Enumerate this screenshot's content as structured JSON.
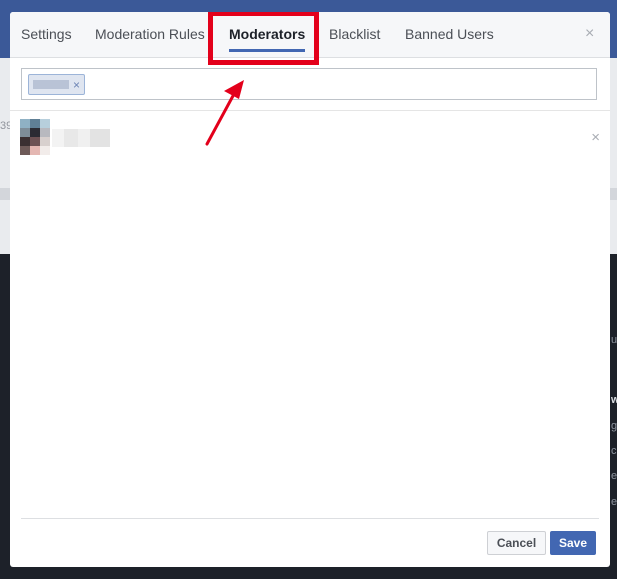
{
  "background": {
    "fragments": [
      "39",
      "u",
      "ws",
      "g",
      "co",
      "ec",
      "ed"
    ]
  },
  "dialog": {
    "tabs": [
      {
        "label": "Settings"
      },
      {
        "label": "Moderation Rules"
      },
      {
        "label": "Moderators"
      },
      {
        "label": "Blacklist"
      },
      {
        "label": "Banned Users"
      }
    ],
    "active_tab": "Moderators",
    "close_glyph": "×",
    "token_input": {
      "token_remove_glyph": "×"
    },
    "moderator_row": {
      "remove_glyph": "×"
    },
    "buttons": {
      "cancel_label": "Cancel",
      "save_label": "Save"
    }
  },
  "colors": {
    "brand": "#4267b2",
    "annotation_red": "#e3001b",
    "header_blue": "#3b5998"
  },
  "icons": {
    "close": "close-icon",
    "remove_token": "remove-token-icon",
    "remove_moderator": "remove-moderator-icon",
    "annotation": "arrow-annotation-icon"
  }
}
